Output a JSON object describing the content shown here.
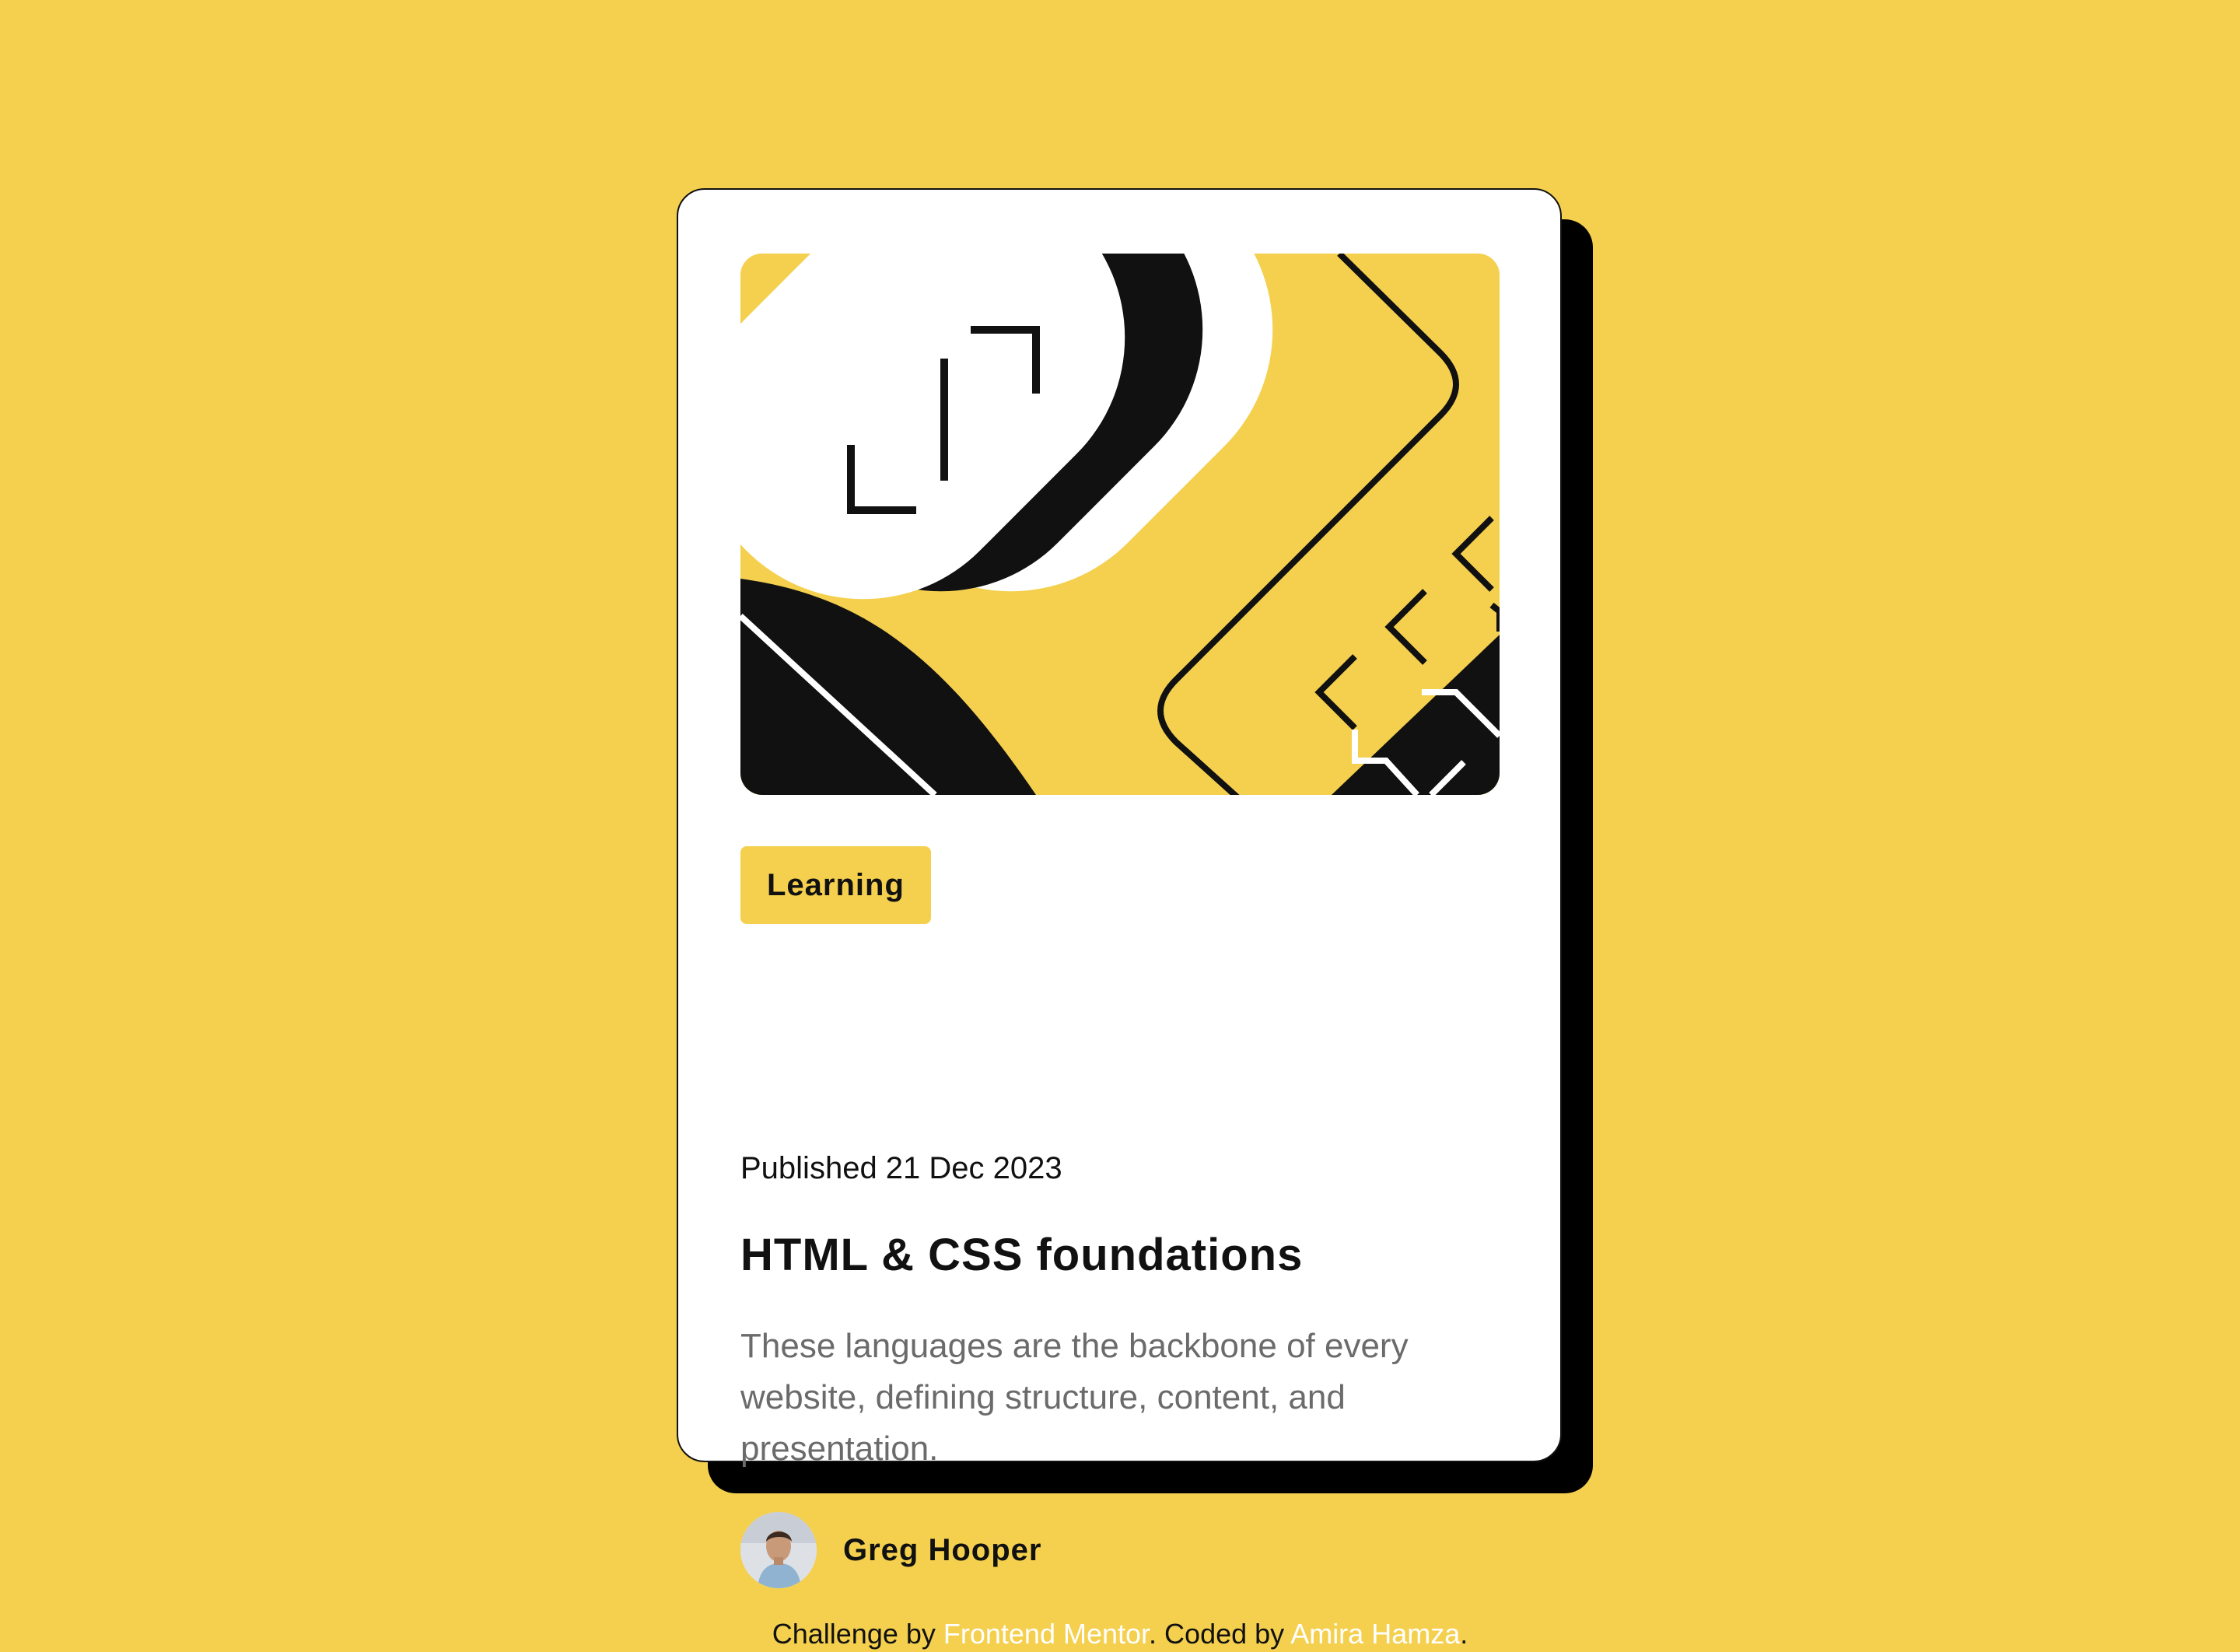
{
  "colors": {
    "background": "#F4D04E",
    "card": "#FFFFFF",
    "shadow": "#000000",
    "text": "#111111",
    "muted": "#6B6B6B",
    "link": "#FFFFFF"
  },
  "card": {
    "illustration_icon": "abstract-geometric-illustration",
    "tag": "Learning",
    "published": "Published 21 Dec 2023",
    "title": "HTML & CSS foundations",
    "description": "These languages are the backbone of every website, defining structure, content, and presentation.",
    "author": {
      "avatar_icon": "avatar-image",
      "name": "Greg Hooper"
    }
  },
  "attribution": {
    "prefix": "Challenge by ",
    "link1": "Frontend Mentor",
    "middle": ". Coded by ",
    "link2": "Amira Hamza",
    "suffix": "."
  }
}
